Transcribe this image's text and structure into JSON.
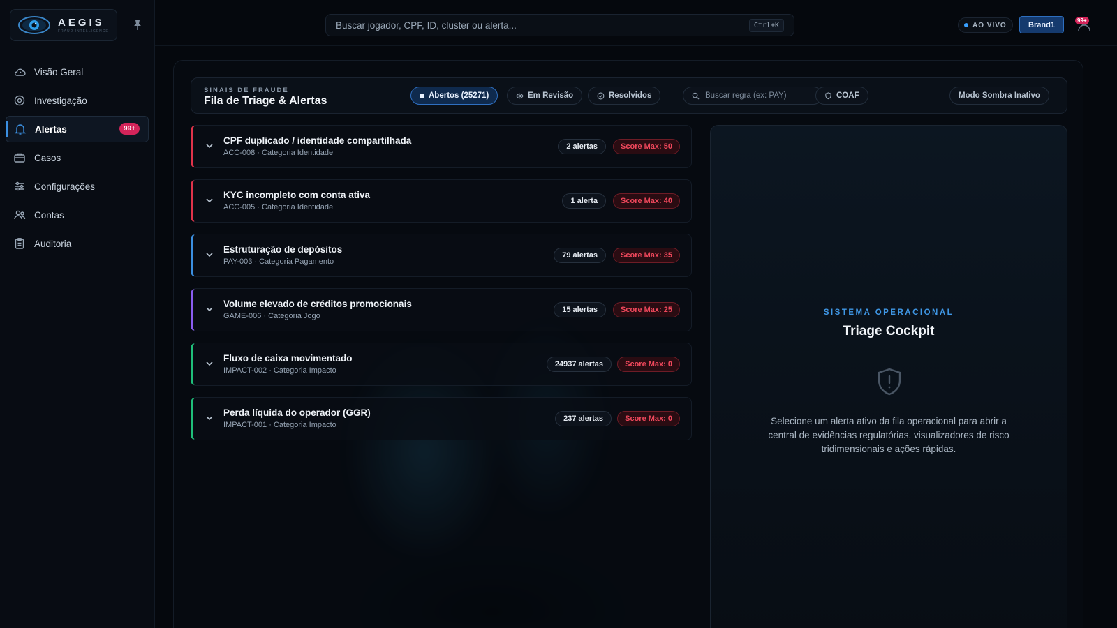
{
  "brand": {
    "name": "AEGIS",
    "sub": "FRAUD INTELLIGENCE"
  },
  "sidebar": {
    "items": [
      {
        "label": "Visão Geral",
        "icon": "cloud-dashboard-icon"
      },
      {
        "label": "Investigação",
        "icon": "target-icon"
      },
      {
        "label": "Alertas",
        "icon": "bell-icon",
        "badge": "99+",
        "active": true
      },
      {
        "label": "Casos",
        "icon": "briefcase-icon"
      },
      {
        "label": "Configurações",
        "icon": "sliders-icon"
      },
      {
        "label": "Contas",
        "icon": "users-icon"
      },
      {
        "label": "Auditoria",
        "icon": "clipboard-icon"
      }
    ]
  },
  "topbar": {
    "search_placeholder": "Buscar jogador, CPF, ID, cluster ou alerta...",
    "shortcut": "Ctrl+K",
    "live_label": "AO VIVO",
    "brand_button": "Brand1",
    "user_badge": "99+"
  },
  "header": {
    "kicker": "SINAIS DE FRAUDE",
    "title": "Fila de Triage & Alertas",
    "tabs": [
      {
        "label": "Abertos (25271)",
        "active": true
      },
      {
        "label": "Em Revisão"
      },
      {
        "label": "Resolvidos"
      }
    ],
    "rule_search_placeholder": "Buscar regra (ex: PAY)",
    "coaf_label": "COAF",
    "shadow_mode_label": "Modo Sombra Inativo"
  },
  "alerts": [
    {
      "title": "CPF duplicado / identidade compartilhada",
      "subtitle": "ACC-008 · Categoria Identidade",
      "count": "2 alertas",
      "score": "Score Max: 50",
      "accent": "#e0334a"
    },
    {
      "title": "KYC incompleto com conta ativa",
      "subtitle": "ACC-005 · Categoria Identidade",
      "count": "1 alerta",
      "score": "Score Max: 40",
      "accent": "#e0334a"
    },
    {
      "title": "Estruturação de depósitos",
      "subtitle": "PAY-003 · Categoria Pagamento",
      "count": "79 alertas",
      "score": "Score Max: 35",
      "accent": "#3b8fe0"
    },
    {
      "title": "Volume elevado de créditos promocionais",
      "subtitle": "GAME-006 · Categoria Jogo",
      "count": "15 alertas",
      "score": "Score Max: 25",
      "accent": "#8a5cf0"
    },
    {
      "title": "Fluxo de caixa movimentado",
      "subtitle": "IMPACT-002 · Categoria Impacto",
      "count": "24937 alertas",
      "score": "Score Max: 0",
      "accent": "#1fbf7a"
    },
    {
      "title": "Perda líquida do operador (GGR)",
      "subtitle": "IMPACT-001 · Categoria Impacto",
      "count": "237 alertas",
      "score": "Score Max: 0",
      "accent": "#1fbf7a"
    }
  ],
  "cockpit": {
    "kicker": "SISTEMA OPERACIONAL",
    "title": "Triage Cockpit",
    "icon": "shield-alert-icon",
    "description": "Selecione um alerta ativo da fila operacional para abrir a central de evidências regulatórias, visualizadores de risco tridimensionais e ações rápidas."
  },
  "colors": {
    "accent": "#3b8fe0",
    "danger": "#e0334a",
    "badge": "#d4245a"
  }
}
